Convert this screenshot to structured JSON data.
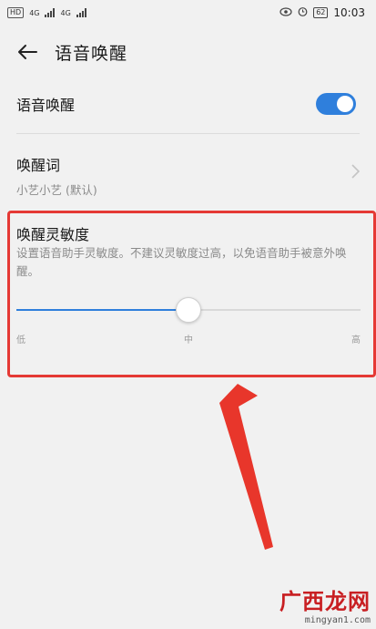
{
  "status_bar": {
    "hd": "HD",
    "net1": "4G",
    "net2": "4G",
    "battery": "62",
    "time": "10:03"
  },
  "app_bar": {
    "title": "语音唤醒"
  },
  "voice_wake": {
    "label": "语音唤醒",
    "enabled": true
  },
  "wake_word": {
    "title": "唤醒词",
    "value": "小艺小艺 (默认)"
  },
  "sensitivity": {
    "title": "唤醒灵敏度",
    "description": "设置语音助手灵敏度。不建议灵敏度过高，以免语音助手被意外唤醒。",
    "value_fraction": 0.5,
    "labels": {
      "low": "低",
      "mid": "中",
      "high": "高"
    }
  },
  "icons": {
    "back": "arrow-left-icon",
    "chevron": "chevron-right-icon"
  },
  "colors": {
    "accent": "#2f7fdc",
    "highlight": "#e53935",
    "arrow": "#e8362b"
  },
  "watermark": {
    "text": "广西龙网",
    "url": "mingyan1.com"
  }
}
